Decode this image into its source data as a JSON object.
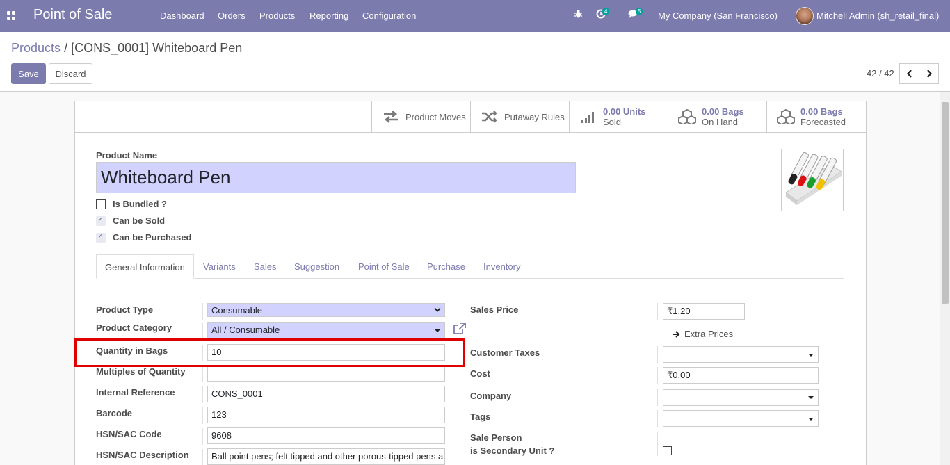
{
  "navbar": {
    "app_title": "Point of Sale",
    "menu": [
      "Dashboard",
      "Orders",
      "Products",
      "Reporting",
      "Configuration"
    ],
    "activity_count": "4",
    "message_count": "5",
    "company": "My Company (San Francisco)",
    "user": "Mitchell Admin (sh_retail_final)",
    "color": "#7c7bad"
  },
  "breadcrumb": {
    "parent": "Products",
    "separator": "/",
    "current": "[CONS_0001] Whiteboard Pen"
  },
  "actions": {
    "save": "Save",
    "discard": "Discard"
  },
  "pager": {
    "value": "42 / 42"
  },
  "smart_buttons": [
    {
      "icon": "exchange-icon",
      "label": "Product Moves"
    },
    {
      "icon": "random-icon",
      "label": "Putaway Rules"
    },
    {
      "icon": "signal-icon",
      "value": "0.00 Units",
      "label": "Sold"
    },
    {
      "icon": "cubes-icon",
      "value": "0.00 Bags",
      "label": "On Hand"
    },
    {
      "icon": "cubes-icon",
      "value": "0.00 Bags",
      "label": "Forecasted"
    }
  ],
  "product": {
    "name_label": "Product Name",
    "name": "Whiteboard Pen",
    "options": [
      {
        "label": "Is Bundled ?",
        "checked": false
      },
      {
        "label": "Can be Sold",
        "checked": true
      },
      {
        "label": "Can be Purchased",
        "checked": true
      }
    ]
  },
  "tabs": [
    "General Information",
    "Variants",
    "Sales",
    "Suggestion",
    "Point of Sale",
    "Purchase",
    "Inventory"
  ],
  "left_fields": {
    "product_type": {
      "label": "Product Type",
      "value": "Consumable"
    },
    "product_category": {
      "label": "Product Category",
      "value": "All / Consumable"
    },
    "qty_bags": {
      "label": "Quantity in Bags",
      "value": "10"
    },
    "multiples": {
      "label": "Multiples of Quantity",
      "value": ""
    },
    "internal_ref": {
      "label": "Internal Reference",
      "value": "CONS_0001"
    },
    "barcode": {
      "label": "Barcode",
      "value": "123"
    },
    "hsn_code": {
      "label": "HSN/SAC Code",
      "value": "9608"
    },
    "hsn_desc": {
      "label": "HSN/SAC Description",
      "value": "Ball point pens; felt tipped and other porous-tipped pens a"
    }
  },
  "right_fields": {
    "sales_price": {
      "label": "Sales Price",
      "value": "₹1.20"
    },
    "extra_prices": "Extra Prices",
    "customer_taxes": {
      "label": "Customer Taxes",
      "value": ""
    },
    "cost": {
      "label": "Cost",
      "value": "₹0.00"
    },
    "company": {
      "label": "Company",
      "value": ""
    },
    "tags": {
      "label": "Tags",
      "value": ""
    },
    "sale_person": {
      "label": "Sale Person"
    },
    "secondary_unit": {
      "label": "is Secondary Unit ?",
      "checked": false
    }
  }
}
